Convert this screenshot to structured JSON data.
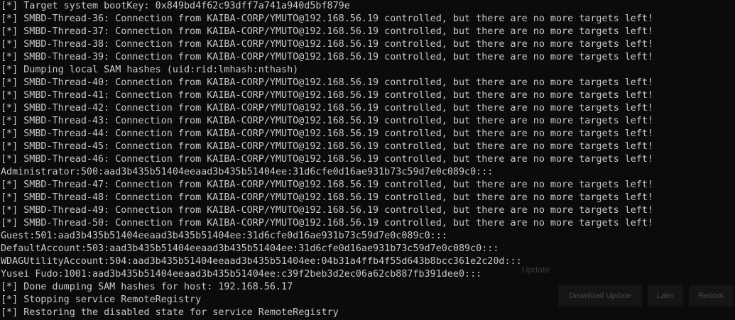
{
  "terminal": {
    "lines": [
      "[*] Target system bootKey: 0x849bd4f62c93dff7a741a940d5bf879e",
      "[*] SMBD-Thread-36: Connection from KAIBA-CORP/YMUTO@192.168.56.19 controlled, but there are no more targets left!",
      "[*] SMBD-Thread-37: Connection from KAIBA-CORP/YMUTO@192.168.56.19 controlled, but there are no more targets left!",
      "[*] SMBD-Thread-38: Connection from KAIBA-CORP/YMUTO@192.168.56.19 controlled, but there are no more targets left!",
      "[*] SMBD-Thread-39: Connection from KAIBA-CORP/YMUTO@192.168.56.19 controlled, but there are no more targets left!",
      "[*] Dumping local SAM hashes (uid:rid:lmhash:nthash)",
      "[*] SMBD-Thread-40: Connection from KAIBA-CORP/YMUTO@192.168.56.19 controlled, but there are no more targets left!",
      "[*] SMBD-Thread-41: Connection from KAIBA-CORP/YMUTO@192.168.56.19 controlled, but there are no more targets left!",
      "[*] SMBD-Thread-42: Connection from KAIBA-CORP/YMUTO@192.168.56.19 controlled, but there are no more targets left!",
      "[*] SMBD-Thread-43: Connection from KAIBA-CORP/YMUTO@192.168.56.19 controlled, but there are no more targets left!",
      "[*] SMBD-Thread-44: Connection from KAIBA-CORP/YMUTO@192.168.56.19 controlled, but there are no more targets left!",
      "[*] SMBD-Thread-45: Connection from KAIBA-CORP/YMUTO@192.168.56.19 controlled, but there are no more targets left!",
      "[*] SMBD-Thread-46: Connection from KAIBA-CORP/YMUTO@192.168.56.19 controlled, but there are no more targets left!",
      "Administrator:500:aad3b435b51404eeaad3b435b51404ee:31d6cfe0d16ae931b73c59d7e0c089c0:::",
      "[*] SMBD-Thread-47: Connection from KAIBA-CORP/YMUTO@192.168.56.19 controlled, but there are no more targets left!",
      "[*] SMBD-Thread-48: Connection from KAIBA-CORP/YMUTO@192.168.56.19 controlled, but there are no more targets left!",
      "[*] SMBD-Thread-49: Connection from KAIBA-CORP/YMUTO@192.168.56.19 controlled, but there are no more targets left!",
      "[*] SMBD-Thread-50: Connection from KAIBA-CORP/YMUTO@192.168.56.19 controlled, but there are no more targets left!",
      "Guest:501:aad3b435b51404eeaad3b435b51404ee:31d6cfe0d16ae931b73c59d7e0c089c0:::",
      "DefaultAccount:503:aad3b435b51404eeaad3b435b51404ee:31d6cfe0d16ae931b73c59d7e0c089c0:::",
      "WDAGUtilityAccount:504:aad3b435b51404eeaad3b435b51404ee:04b31a4ffb4f55d643b8bcc361e2c20d:::",
      "Yusei Fudo:1001:aad3b435b51404eeaad3b435b51404ee:c39f2beb3d2ec06a62cb887fb391dee0:::",
      "[*] Done dumping SAM hashes for host: 192.168.56.17",
      "[*] Stopping service RemoteRegistry",
      "[*] Restoring the disabled state for service RemoteRegistry"
    ]
  },
  "ghost_overlay": {
    "text": "Update",
    "buttons": [
      "Download Update",
      "Later",
      "Reboot"
    ]
  },
  "colors": {
    "background": "#0b0b0b",
    "text": "#c8c8c8"
  }
}
